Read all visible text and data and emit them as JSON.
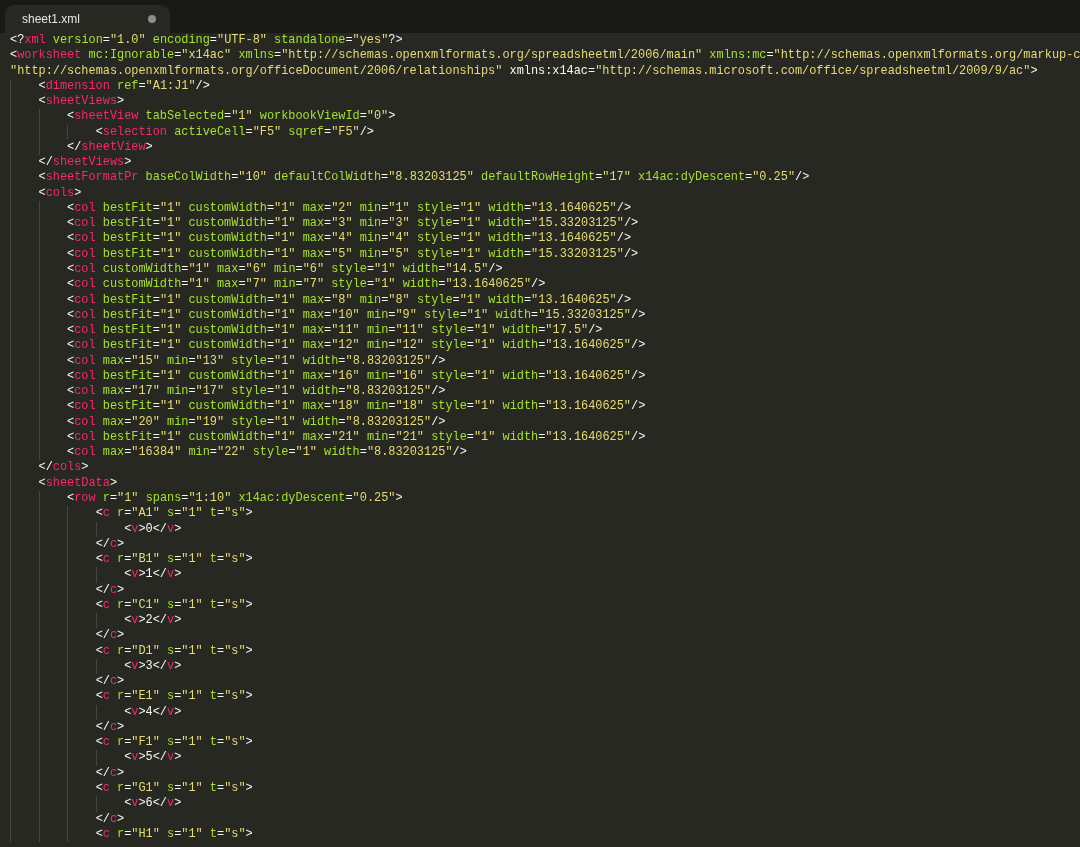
{
  "tab": {
    "title": "sheet1.xml",
    "modified": true
  },
  "lines": [
    {
      "text": "<?xml version=\"1.0\" encoding=\"UTF-8\" standalone=\"yes\"?>"
    },
    {
      "text": "<worksheet mc:Ignorable=\"x14ac\" xmlns=\"http://schemas.openxmlformats.org/spreadsheetml/2006/main\" xmlns:mc=\"http://schemas.openxmlformats.org/markup-c"
    },
    {
      "text": "\"http://schemas.openxmlformats.org/officeDocument/2006/relationships\" xmlns:x14ac=\"http://schemas.microsoft.com/office/spreadsheetml/2009/9/ac\">",
      "children": [
        {
          "text": "<dimension ref=\"A1:J1\"/>"
        },
        {
          "text": "<sheetViews>",
          "children": [
            {
              "text": "<sheetView tabSelected=\"1\" workbookViewId=\"0\">",
              "children": [
                {
                  "text": "<selection activeCell=\"F5\" sqref=\"F5\"/>"
                }
              ]
            },
            {
              "text": "</sheetView>"
            }
          ]
        },
        {
          "text": "</sheetViews>"
        },
        {
          "text": "<sheetFormatPr baseColWidth=\"10\" defaultColWidth=\"8.83203125\" defaultRowHeight=\"17\" x14ac:dyDescent=\"0.25\"/>"
        },
        {
          "text": "<cols>",
          "children": [
            {
              "text": "<col bestFit=\"1\" customWidth=\"1\" max=\"2\" min=\"1\" style=\"1\" width=\"13.1640625\"/>"
            },
            {
              "text": "<col bestFit=\"1\" customWidth=\"1\" max=\"3\" min=\"3\" style=\"1\" width=\"15.33203125\"/>"
            },
            {
              "text": "<col bestFit=\"1\" customWidth=\"1\" max=\"4\" min=\"4\" style=\"1\" width=\"13.1640625\"/>"
            },
            {
              "text": "<col bestFit=\"1\" customWidth=\"1\" max=\"5\" min=\"5\" style=\"1\" width=\"15.33203125\"/>"
            },
            {
              "text": "<col customWidth=\"1\" max=\"6\" min=\"6\" style=\"1\" width=\"14.5\"/>"
            },
            {
              "text": "<col customWidth=\"1\" max=\"7\" min=\"7\" style=\"1\" width=\"13.1640625\"/>"
            },
            {
              "text": "<col bestFit=\"1\" customWidth=\"1\" max=\"8\" min=\"8\" style=\"1\" width=\"13.1640625\"/>"
            },
            {
              "text": "<col bestFit=\"1\" customWidth=\"1\" max=\"10\" min=\"9\" style=\"1\" width=\"15.33203125\"/>"
            },
            {
              "text": "<col bestFit=\"1\" customWidth=\"1\" max=\"11\" min=\"11\" style=\"1\" width=\"17.5\"/>"
            },
            {
              "text": "<col bestFit=\"1\" customWidth=\"1\" max=\"12\" min=\"12\" style=\"1\" width=\"13.1640625\"/>"
            },
            {
              "text": "<col max=\"15\" min=\"13\" style=\"1\" width=\"8.83203125\"/>"
            },
            {
              "text": "<col bestFit=\"1\" customWidth=\"1\" max=\"16\" min=\"16\" style=\"1\" width=\"13.1640625\"/>"
            },
            {
              "text": "<col max=\"17\" min=\"17\" style=\"1\" width=\"8.83203125\"/>"
            },
            {
              "text": "<col bestFit=\"1\" customWidth=\"1\" max=\"18\" min=\"18\" style=\"1\" width=\"13.1640625\"/>"
            },
            {
              "text": "<col max=\"20\" min=\"19\" style=\"1\" width=\"8.83203125\"/>"
            },
            {
              "text": "<col bestFit=\"1\" customWidth=\"1\" max=\"21\" min=\"21\" style=\"1\" width=\"13.1640625\"/>"
            },
            {
              "text": "<col max=\"16384\" min=\"22\" style=\"1\" width=\"8.83203125\"/>"
            }
          ]
        },
        {
          "text": "</cols>"
        },
        {
          "text": "<sheetData>",
          "children": [
            {
              "text": "<row r=\"1\" spans=\"1:10\" x14ac:dyDescent=\"0.25\">",
              "children": [
                {
                  "text": "<c r=\"A1\" s=\"1\" t=\"s\">",
                  "children": [
                    {
                      "text": "<v>0</v>"
                    }
                  ]
                },
                {
                  "text": "</c>"
                },
                {
                  "text": "<c r=\"B1\" s=\"1\" t=\"s\">",
                  "children": [
                    {
                      "text": "<v>1</v>"
                    }
                  ]
                },
                {
                  "text": "</c>"
                },
                {
                  "text": "<c r=\"C1\" s=\"1\" t=\"s\">",
                  "children": [
                    {
                      "text": "<v>2</v>"
                    }
                  ]
                },
                {
                  "text": "</c>"
                },
                {
                  "text": "<c r=\"D1\" s=\"1\" t=\"s\">",
                  "children": [
                    {
                      "text": "<v>3</v>"
                    }
                  ]
                },
                {
                  "text": "</c>"
                },
                {
                  "text": "<c r=\"E1\" s=\"1\" t=\"s\">",
                  "children": [
                    {
                      "text": "<v>4</v>"
                    }
                  ]
                },
                {
                  "text": "</c>"
                },
                {
                  "text": "<c r=\"F1\" s=\"1\" t=\"s\">",
                  "children": [
                    {
                      "text": "<v>5</v>"
                    }
                  ]
                },
                {
                  "text": "</c>"
                },
                {
                  "text": "<c r=\"G1\" s=\"1\" t=\"s\">",
                  "children": [
                    {
                      "text": "<v>6</v>"
                    }
                  ]
                },
                {
                  "text": "</c>"
                },
                {
                  "text": "<c r=\"H1\" s=\"1\" t=\"s\">"
                }
              ]
            }
          ]
        }
      ]
    }
  ]
}
